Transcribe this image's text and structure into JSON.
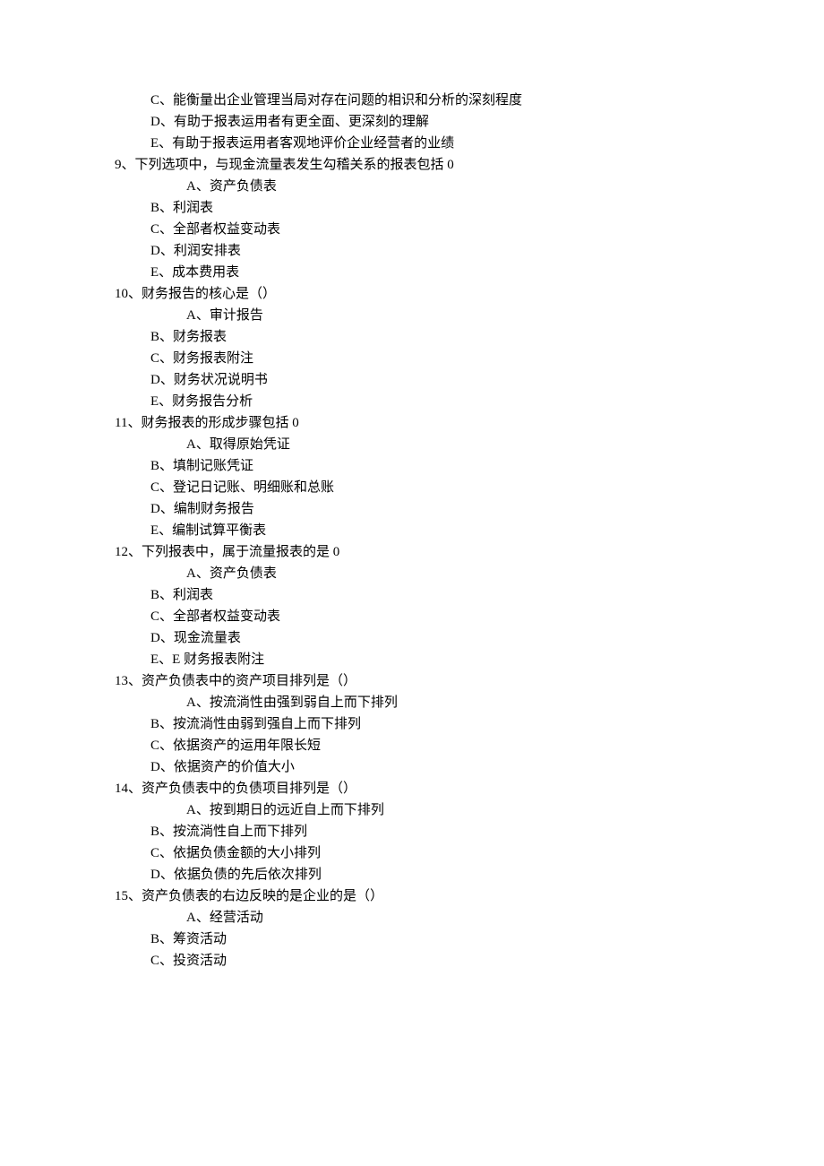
{
  "questions": [
    {
      "number": "",
      "stem": "",
      "options": [
        {
          "text": "C、能衡量出企业管理当局对存在问题的相识和分析的深刻程度",
          "first": false
        },
        {
          "text": "D、有助于报表运用者有更全面、更深刻的理解",
          "first": false
        },
        {
          "text": "E、有助于报表运用者客观地评价企业经营者的业绩",
          "first": false
        }
      ]
    },
    {
      "number": "9、",
      "stem": "下列选项中，与现金流量表发生勾稽关系的报表包括 0",
      "options": [
        {
          "text": "A、资产负债表",
          "first": true
        },
        {
          "text": "B、利润表",
          "first": false
        },
        {
          "text": "C、全部者权益变动表",
          "first": false
        },
        {
          "text": "D、利润安排表",
          "first": false
        },
        {
          "text": "E、成本费用表",
          "first": false
        }
      ]
    },
    {
      "number": "10、",
      "stem": "财务报告的核心是（）",
      "options": [
        {
          "text": "A、审计报告",
          "first": true
        },
        {
          "text": "B、财务报表",
          "first": false
        },
        {
          "text": "C、财务报表附注",
          "first": false
        },
        {
          "text": "D、财务状况说明书",
          "first": false
        },
        {
          "text": "E、财务报告分析",
          "first": false
        }
      ]
    },
    {
      "number": "11、",
      "stem": "财务报表的形成步骤包括 0",
      "options": [
        {
          "text": "A、取得原始凭证",
          "first": true
        },
        {
          "text": "B、填制记账凭证",
          "first": false
        },
        {
          "text": "C、登记日记账、明细账和总账",
          "first": false
        },
        {
          "text": "D、编制财务报告",
          "first": false
        },
        {
          "text": "E、编制试算平衡表",
          "first": false
        }
      ]
    },
    {
      "number": "12、",
      "stem": "下列报表中，属于流量报表的是 0",
      "options": [
        {
          "text": "A、资产负债表",
          "first": true
        },
        {
          "text": "B、利润表",
          "first": false
        },
        {
          "text": "C、全部者权益变动表",
          "first": false
        },
        {
          "text": "D、现金流量表",
          "first": false
        },
        {
          "text": "E、E 财务报表附注",
          "first": false
        }
      ]
    },
    {
      "number": "13、",
      "stem": "资产负债表中的资产项目排列是（）",
      "options": [
        {
          "text": "A、按流淌性由强到弱自上而下排列",
          "first": true
        },
        {
          "text": "B、按流淌性由弱到强自上而下排列",
          "first": false
        },
        {
          "text": "C、依据资产的运用年限长短",
          "first": false
        },
        {
          "text": "D、依据资产的价值大小",
          "first": false
        }
      ]
    },
    {
      "number": "14、",
      "stem": "资产负债表中的负债项目排列是（）",
      "options": [
        {
          "text": "A、按到期日的远近自上而下排列",
          "first": true
        },
        {
          "text": "B、按流淌性自上而下排列",
          "first": false
        },
        {
          "text": "C、依据负债金额的大小排列",
          "first": false
        },
        {
          "text": "D、依据负债的先后依次排列",
          "first": false
        }
      ]
    },
    {
      "number": "15、",
      "stem": "资产负债表的右边反映的是企业的是（）",
      "options": [
        {
          "text": "A、经营活动",
          "first": true
        },
        {
          "text": "B、筹资活动",
          "first": false
        },
        {
          "text": "C、投资活动",
          "first": false
        }
      ]
    }
  ]
}
